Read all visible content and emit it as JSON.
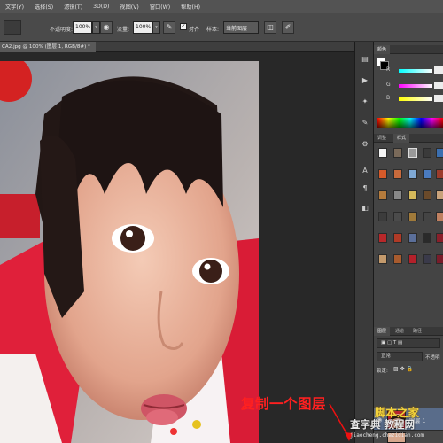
{
  "menu": [
    "文字(Y)",
    "选择(S)",
    "滤镜(T)",
    "3D(D)",
    "视图(V)",
    "窗口(W)",
    "帮助(H)"
  ],
  "options_bar": {
    "opacity_label": "不透明度:",
    "opacity_value": "100%",
    "flow_label": "流量:",
    "flow_value": "100%",
    "align_label": "对齐",
    "sample_label": "样本:",
    "sample_value": "当前图层"
  },
  "document_tab": {
    "title": "CA2.jpg @ 100% (图层 1, RGB/8#) *"
  },
  "panels": {
    "color_tab": "颜色",
    "channels": [
      "R",
      "G",
      "B"
    ],
    "adjust_tabs": [
      "调整",
      "样式"
    ],
    "layer_tabs": [
      "图层",
      "通道",
      "路径"
    ],
    "blend_mode": "正常",
    "opacity_label": "不透明",
    "lock_label": "锁定:",
    "layers": [
      {
        "name": "图层 1"
      }
    ]
  },
  "annotation": {
    "text": "复制一个图层"
  },
  "watermark": {
    "line1": "脚本之家",
    "line2": "查字典 教程网",
    "line3": "jiaocheng.chazidian.com"
  },
  "colors": {
    "annotation_red": "#ff2020",
    "layer_selected": "#596c8a",
    "watermark_gold": "#f3d33b"
  }
}
